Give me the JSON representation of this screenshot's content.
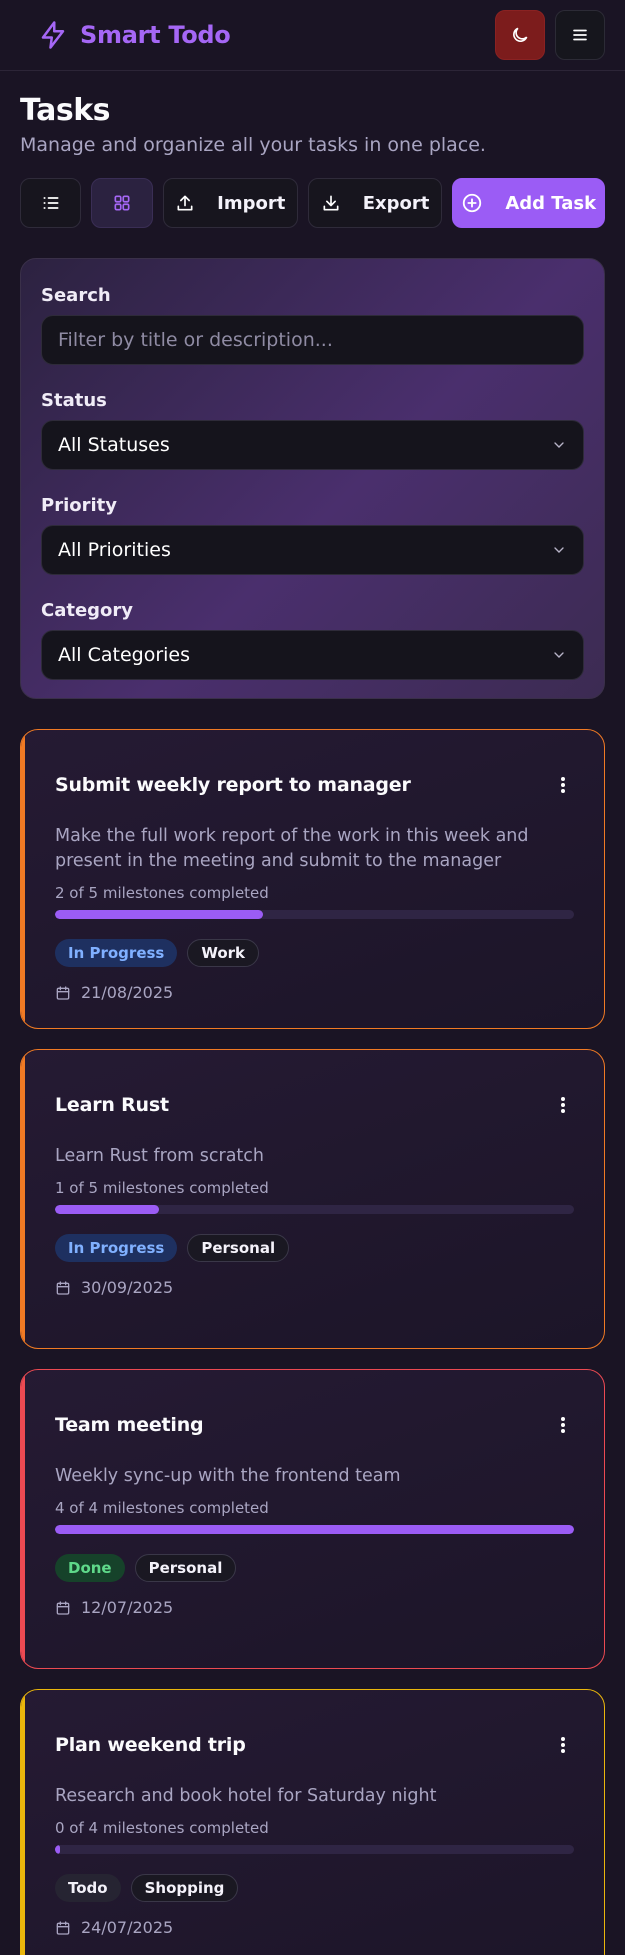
{
  "header": {
    "brand": "Smart Todo",
    "brand_icon": "lightning-icon",
    "theme_icon": "moon-icon",
    "menu_icon": "hamburger-menu-icon"
  },
  "page": {
    "title": "Tasks",
    "subtitle": "Manage and organize all your tasks in one place."
  },
  "toolbar": {
    "list_view_icon": "list-icon",
    "grid_view_icon": "grid-icon",
    "import_label": "Import",
    "export_label": "Export",
    "add_label": "Add Task"
  },
  "filters": {
    "search_label": "Search",
    "search_placeholder": "Filter by title or description...",
    "status_label": "Status",
    "status_value": "All Statuses",
    "priority_label": "Priority",
    "priority_value": "All Priorities",
    "category_label": "Category",
    "category_value": "All Categories"
  },
  "tasks": [
    {
      "title": "Submit weekly report to manager",
      "description": "Make the full work report of the work in this week and present in the meeting and submit to the manager",
      "milestones": "2 of 5 milestones completed",
      "progress": 0.4,
      "status": "In Progress",
      "category": "Work",
      "date": "21/08/2025",
      "accent": "#f07a24"
    },
    {
      "title": "Learn Rust",
      "description": "Learn Rust from scratch",
      "milestones": "1 of 5 milestones completed",
      "progress": 0.2,
      "status": "In Progress",
      "category": "Personal",
      "date": "30/09/2025",
      "accent": "#f07a24"
    },
    {
      "title": "Team meeting",
      "description": "Weekly sync-up with the frontend team",
      "milestones": "4 of 4 milestones completed",
      "progress": 1.0,
      "status": "Done",
      "category": "Personal",
      "date": "12/07/2025",
      "accent": "#ec4a52"
    },
    {
      "title": "Plan weekend trip",
      "description": "Research and book hotel for Saturday night",
      "milestones": "0 of 4 milestones completed",
      "progress": 0.0,
      "status": "Todo",
      "category": "Shopping",
      "date": "24/07/2025",
      "accent": "#eab60c"
    }
  ]
}
